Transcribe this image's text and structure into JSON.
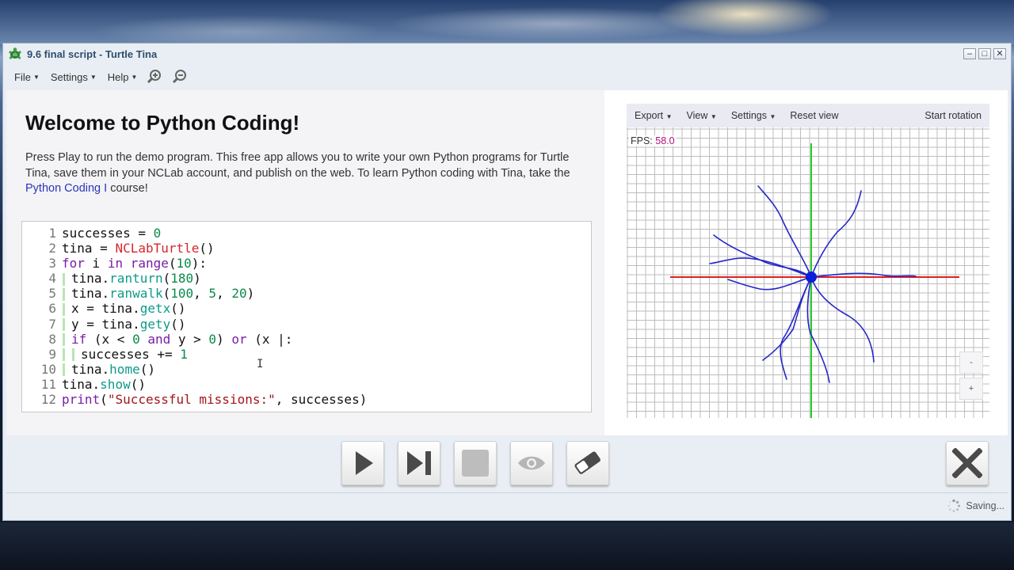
{
  "window": {
    "title": "9.6 final script - Turtle Tina",
    "controls": [
      "minimize-icon",
      "maximize-icon",
      "close-icon"
    ]
  },
  "menu": {
    "file": "File",
    "settings": "Settings",
    "help": "Help",
    "icons": [
      "zoom-in-icon",
      "zoom-out-icon"
    ]
  },
  "intro": {
    "heading": "Welcome to Python Coding!",
    "text_before": "Press Play to run the demo program. This free app allows you to write your own Python programs for Turtle Tina, save them in your NCLab account, and publish on the web. To learn Python coding with Tina, take the ",
    "link": "Python Coding I",
    "text_after": " course!"
  },
  "editor": {
    "lines": [
      {
        "n": "1",
        "tokens": [
          [
            "ct",
            "successes = "
          ],
          [
            "num",
            "0"
          ]
        ]
      },
      {
        "n": "2",
        "tokens": [
          [
            "ct",
            "tina = "
          ],
          [
            "cls",
            "NCLabTurtle"
          ],
          [
            "ct",
            "()"
          ]
        ]
      },
      {
        "n": "3",
        "tokens": [
          [
            "kw",
            "for"
          ],
          [
            "ct",
            " i "
          ],
          [
            "kw",
            "in"
          ],
          [
            "ct",
            " "
          ],
          [
            "kw",
            "range"
          ],
          [
            "ct",
            "("
          ],
          [
            "num",
            "10"
          ],
          [
            "ct",
            "):"
          ]
        ]
      },
      {
        "n": "4",
        "indent": 1,
        "tokens": [
          [
            "ct",
            "tina."
          ],
          [
            "fn",
            "ranturn"
          ],
          [
            "ct",
            "("
          ],
          [
            "num",
            "180"
          ],
          [
            "ct",
            ")"
          ]
        ]
      },
      {
        "n": "5",
        "indent": 1,
        "tokens": [
          [
            "ct",
            "tina."
          ],
          [
            "fn",
            "ranwalk"
          ],
          [
            "ct",
            "("
          ],
          [
            "num",
            "100"
          ],
          [
            "ct",
            ", "
          ],
          [
            "num",
            "5"
          ],
          [
            "ct",
            ", "
          ],
          [
            "num",
            "20"
          ],
          [
            "ct",
            ")"
          ]
        ]
      },
      {
        "n": "6",
        "indent": 1,
        "tokens": [
          [
            "ct",
            "x = tina."
          ],
          [
            "fn",
            "getx"
          ],
          [
            "ct",
            "()"
          ]
        ]
      },
      {
        "n": "7",
        "indent": 1,
        "tokens": [
          [
            "ct",
            "y = tina."
          ],
          [
            "fn",
            "gety"
          ],
          [
            "ct",
            "()"
          ]
        ]
      },
      {
        "n": "8",
        "indent": 1,
        "tokens": [
          [
            "kw",
            "if"
          ],
          [
            "ct",
            " (x < "
          ],
          [
            "num",
            "0"
          ],
          [
            "ct",
            " "
          ],
          [
            "kw",
            "and"
          ],
          [
            "ct",
            " y > "
          ],
          [
            "num",
            "0"
          ],
          [
            "ct",
            ") "
          ],
          [
            "kw",
            "or"
          ],
          [
            "ct",
            " (x |:"
          ]
        ]
      },
      {
        "n": "9",
        "indent": 2,
        "tokens": [
          [
            "ct",
            "successes += "
          ],
          [
            "num",
            "1"
          ]
        ]
      },
      {
        "n": "10",
        "indent": 1,
        "tokens": [
          [
            "ct",
            "tina."
          ],
          [
            "fn",
            "home"
          ],
          [
            "ct",
            "()"
          ]
        ]
      },
      {
        "n": "11",
        "tokens": [
          [
            "ct",
            "tina."
          ],
          [
            "fn",
            "show"
          ],
          [
            "ct",
            "()"
          ]
        ]
      },
      {
        "n": "12",
        "tokens": [
          [
            "kw",
            "print"
          ],
          [
            "ct",
            "("
          ],
          [
            "str",
            "\"Successful missions:\""
          ],
          [
            "ct",
            ", successes)"
          ]
        ]
      }
    ],
    "text_cursor": "I"
  },
  "canvas": {
    "toolbar": {
      "export": "Export",
      "view": "View",
      "settings": "Settings",
      "reset": "Reset view",
      "rotation": "Start rotation"
    },
    "fps_label": "FPS:",
    "fps_value": "58.0",
    "zoom_out": "-",
    "zoom_in": "+",
    "colors": {
      "grid": "#bdbdbd",
      "x_axis": "#e02020",
      "y_axis": "#22cc22",
      "path": "#2626c8",
      "turtle": "#0b1fd6"
    }
  },
  "player": {
    "buttons": [
      "play-icon",
      "step-icon",
      "stop-icon",
      "eye-icon",
      "eraser-icon"
    ],
    "close": "close-icon"
  },
  "status": {
    "text": "Saving...",
    "icon": "spinner-icon"
  }
}
